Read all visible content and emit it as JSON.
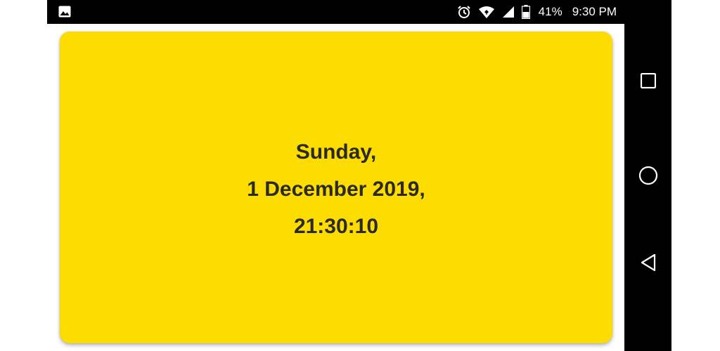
{
  "status_bar": {
    "left_icon": "image-icon",
    "icons": [
      "alarm-icon",
      "wifi-icon",
      "cell-signal-icon",
      "battery-icon"
    ],
    "battery": "41%",
    "time": "9:30 PM"
  },
  "card": {
    "background": "#fddc00",
    "lines": [
      "Sunday,",
      "1 December 2019,",
      "21:30:10"
    ]
  },
  "nav_bar": {
    "buttons": [
      "recents-square-icon",
      "home-circle-icon",
      "back-triangle-icon"
    ]
  }
}
